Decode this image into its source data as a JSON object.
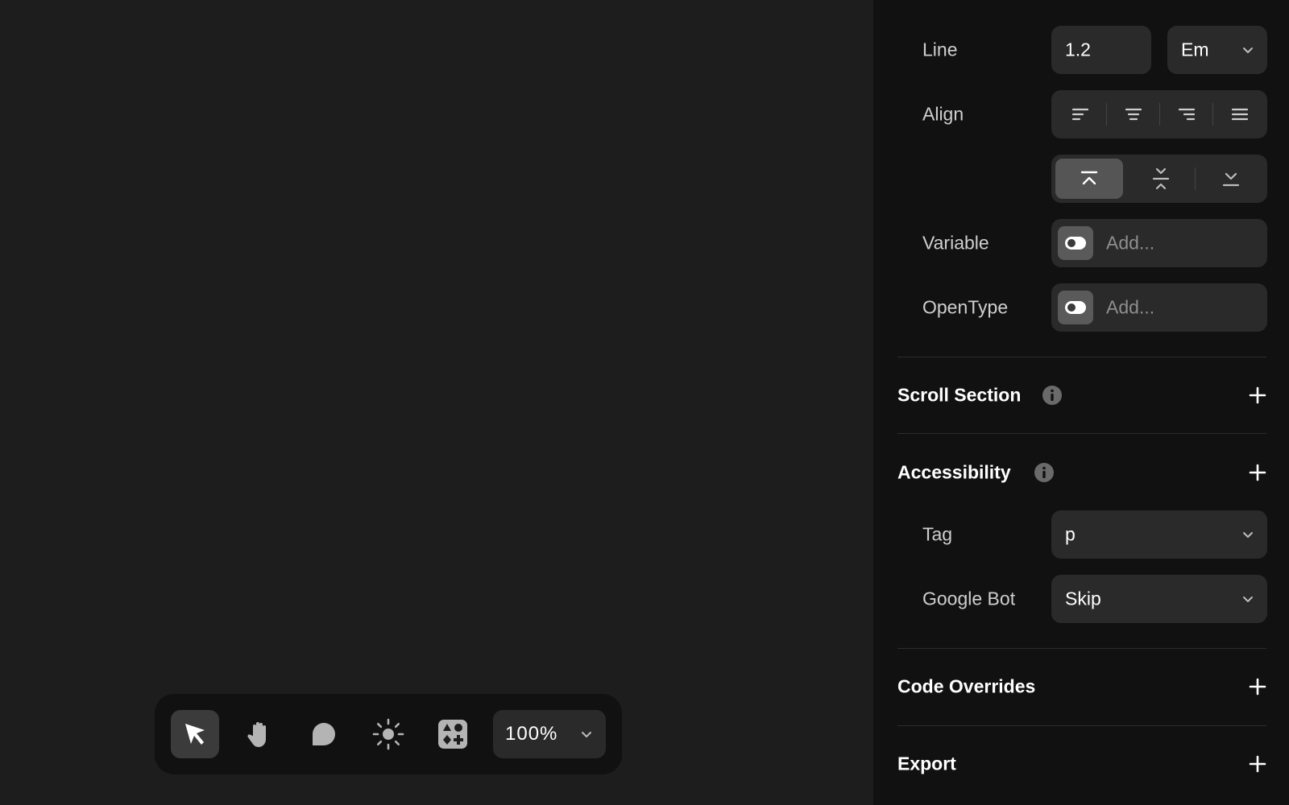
{
  "typography": {
    "line": {
      "label": "Line",
      "value": "1.2",
      "unit": "Em"
    },
    "align": {
      "label": "Align",
      "options": [
        "left-align-icon",
        "center-align-icon",
        "right-align-icon",
        "justify-align-icon"
      ]
    },
    "vertical_align": {
      "options": [
        "align-top-icon",
        "align-middle-icon",
        "align-bottom-icon"
      ],
      "selected": 0
    },
    "variable": {
      "label": "Variable",
      "placeholder": "Add..."
    },
    "opentype": {
      "label": "OpenType",
      "placeholder": "Add..."
    }
  },
  "sections": {
    "scroll_section": {
      "title": "Scroll Section"
    },
    "accessibility": {
      "title": "Accessibility"
    },
    "code_overrides": {
      "title": "Code Overrides"
    },
    "export": {
      "title": "Export"
    }
  },
  "accessibility": {
    "tag": {
      "label": "Tag",
      "value": "p"
    },
    "google_bot": {
      "label": "Google Bot",
      "value": "Skip"
    }
  },
  "toolbar": {
    "tools": [
      "pointer-icon",
      "hand-icon",
      "comment-icon",
      "sun-icon",
      "components-icon"
    ],
    "active_tool": 0,
    "zoom": "100%"
  },
  "colors": {
    "canvas": "#1d1d1d",
    "panel": "#111111",
    "field": "#2a2a2a",
    "active": "#555555"
  }
}
